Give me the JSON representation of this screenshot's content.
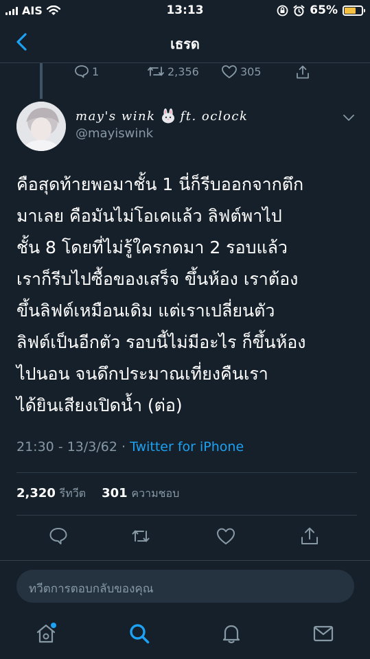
{
  "status_bar": {
    "carrier": "AIS",
    "time": "13:13",
    "battery": "65%",
    "battery_level": 0.65
  },
  "header": {
    "title": "เธรด"
  },
  "previous_tweet": {
    "replies": "1",
    "retweets": "2,356",
    "likes": "305"
  },
  "tweet": {
    "display_name": "may's wink",
    "display_name_suffix": "ft. oclock",
    "handle": "@mayiswink",
    "text_lines": [
      "คือสุดท้ายพอมาชั้น 1 นี่ก็รีบออกจากตึก",
      "มาเลย คือมันไม่โอเคแล้ว ลิฟต์พาไป",
      "ชั้น 8 โดยที่ไม่รู้ใครกดมา 2 รอบแล้ว",
      "เราก็รีบไปซื้อของเสร็จ ขึ้นห้อง เราต้อง",
      "ขึ้นลิฟต์เหมือนเดิม แต่เราเปลี่ยนตัว",
      "ลิฟต์เป็นอีกตัว รอบนี้ไม่มีอะไร ก็ขึ้นห้อง",
      "ไปนอน จนดึกประมาณเที่ยงคืนเรา",
      "ได้ยินเสียงเปิดน้ำ (ต่อ)"
    ],
    "time": "21:30",
    "date": "13/3/62",
    "separator": "·",
    "source": "Twitter for iPhone",
    "retweet_count": "2,320",
    "retweet_label": "รีทวีต",
    "like_count": "301",
    "like_label": "ความชอบ"
  },
  "reply": {
    "placeholder": "ทวีตการตอบกลับของคุณ"
  },
  "colors": {
    "background": "#15202b",
    "accent": "#1da1f2",
    "muted": "#8899a6",
    "divider": "#2f3d4a",
    "battery": "#f6c143"
  },
  "icons": {
    "status": [
      "signal-icon",
      "wifi-icon",
      "rotation-lock-icon",
      "alarm-icon",
      "battery-icon"
    ],
    "header": [
      "back-arrow-icon"
    ],
    "actions": [
      "reply-icon",
      "retweet-icon",
      "like-icon",
      "share-icon"
    ],
    "tabs": [
      "home-icon",
      "search-icon",
      "notifications-icon",
      "messages-icon"
    ]
  }
}
